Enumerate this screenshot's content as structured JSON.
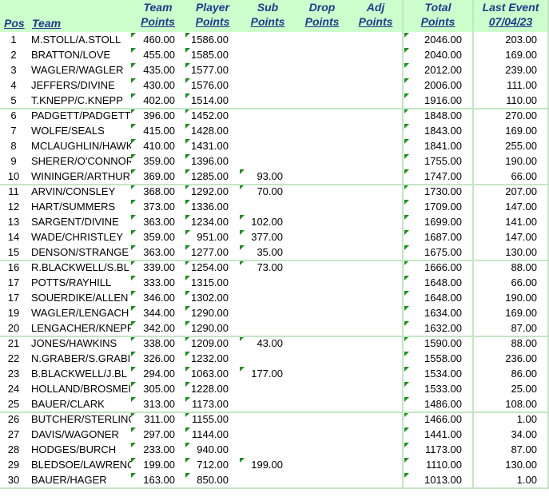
{
  "headers": {
    "pos": "Pos",
    "team": "Team",
    "team_points": [
      "Team",
      "Points"
    ],
    "player_points": [
      "Player",
      "Points"
    ],
    "sub_points": [
      "Sub",
      "Points"
    ],
    "drop_points": [
      "Drop",
      "Points"
    ],
    "adj_points": [
      "Adj",
      "Points"
    ],
    "total_points": [
      "Total",
      "Points"
    ],
    "last_event": [
      "Last Event",
      "07/04/23"
    ]
  },
  "rows": [
    {
      "pos": "1",
      "team": "M.STOLL/A.STOLL",
      "team_points": "460.00",
      "player_points": "1586.00",
      "sub_points": "",
      "total": "2046.00",
      "last_event": "203.00"
    },
    {
      "pos": "2",
      "team": "BRATTON/LOVE",
      "team_points": "455.00",
      "player_points": "1585.00",
      "sub_points": "",
      "total": "2040.00",
      "last_event": "169.00"
    },
    {
      "pos": "3",
      "team": "WAGLER/WAGLER",
      "team_points": "435.00",
      "player_points": "1577.00",
      "sub_points": "",
      "total": "2012.00",
      "last_event": "239.00"
    },
    {
      "pos": "4",
      "team": "JEFFERS/DIVINE",
      "team_points": "430.00",
      "player_points": "1576.00",
      "sub_points": "",
      "total": "2006.00",
      "last_event": "111.00"
    },
    {
      "pos": "5",
      "team": "T.KNEPP/C.KNEPP",
      "team_points": "402.00",
      "player_points": "1514.00",
      "sub_points": "",
      "total": "1916.00",
      "last_event": "110.00"
    },
    {
      "pos": "6",
      "team": "PADGETT/PADGETT",
      "team_points": "396.00",
      "player_points": "1452.00",
      "sub_points": "",
      "total": "1848.00",
      "last_event": "270.00"
    },
    {
      "pos": "7",
      "team": "WOLFE/SEALS",
      "team_points": "415.00",
      "player_points": "1428.00",
      "sub_points": "",
      "total": "1843.00",
      "last_event": "169.00"
    },
    {
      "pos": "8",
      "team": "MCLAUGHLIN/HAWK",
      "team_points": "410.00",
      "player_points": "1431.00",
      "sub_points": "",
      "total": "1841.00",
      "last_event": "255.00"
    },
    {
      "pos": "9",
      "team": "SHERER/O'CONNOR",
      "team_points": "359.00",
      "player_points": "1396.00",
      "sub_points": "",
      "total": "1755.00",
      "last_event": "190.00"
    },
    {
      "pos": "10",
      "team": "WININGER/ARTHUR",
      "team_points": "369.00",
      "player_points": "1285.00",
      "sub_points": "93.00",
      "total": "1747.00",
      "last_event": "66.00"
    },
    {
      "pos": "11",
      "team": "ARVIN/CONSLEY",
      "team_points": "368.00",
      "player_points": "1292.00",
      "sub_points": "70.00",
      "total": "1730.00",
      "last_event": "207.00"
    },
    {
      "pos": "12",
      "team": "HART/SUMMERS",
      "team_points": "373.00",
      "player_points": "1336.00",
      "sub_points": "",
      "total": "1709.00",
      "last_event": "147.00"
    },
    {
      "pos": "13",
      "team": "SARGENT/DIVINE",
      "team_points": "363.00",
      "player_points": "1234.00",
      "sub_points": "102.00",
      "total": "1699.00",
      "last_event": "141.00"
    },
    {
      "pos": "14",
      "team": "WADE/CHRISTLEY",
      "team_points": "359.00",
      "player_points": "951.00",
      "sub_points": "377.00",
      "total": "1687.00",
      "last_event": "147.00"
    },
    {
      "pos": "15",
      "team": "DENSON/STRANGE",
      "team_points": "363.00",
      "player_points": "1277.00",
      "sub_points": "35.00",
      "total": "1675.00",
      "last_event": "130.00"
    },
    {
      "pos": "16",
      "team": "R.BLACKWELL/S.BL",
      "team_points": "339.00",
      "player_points": "1254.00",
      "sub_points": "73.00",
      "total": "1666.00",
      "last_event": "88.00"
    },
    {
      "pos": "17",
      "team": "POTTS/RAYHILL",
      "team_points": "333.00",
      "player_points": "1315.00",
      "sub_points": "",
      "total": "1648.00",
      "last_event": "66.00"
    },
    {
      "pos": "17",
      "team": "SOUERDIKE/ALLEN",
      "team_points": "346.00",
      "player_points": "1302.00",
      "sub_points": "",
      "total": "1648.00",
      "last_event": "190.00"
    },
    {
      "pos": "19",
      "team": "WAGLER/LENGACH",
      "team_points": "344.00",
      "player_points": "1290.00",
      "sub_points": "",
      "total": "1634.00",
      "last_event": "169.00"
    },
    {
      "pos": "20",
      "team": "LENGACHER/KNEPP",
      "team_points": "342.00",
      "player_points": "1290.00",
      "sub_points": "",
      "total": "1632.00",
      "last_event": "87.00"
    },
    {
      "pos": "21",
      "team": "JONES/HAWKINS",
      "team_points": "338.00",
      "player_points": "1209.00",
      "sub_points": "43.00",
      "total": "1590.00",
      "last_event": "88.00"
    },
    {
      "pos": "22",
      "team": "N.GRABER/S.GRABI",
      "team_points": "326.00",
      "player_points": "1232.00",
      "sub_points": "",
      "total": "1558.00",
      "last_event": "236.00"
    },
    {
      "pos": "23",
      "team": "B.BLACKWELL/J.BL",
      "team_points": "294.00",
      "player_points": "1063.00",
      "sub_points": "177.00",
      "total": "1534.00",
      "last_event": "86.00"
    },
    {
      "pos": "24",
      "team": "HOLLAND/BROSMEI",
      "team_points": "305.00",
      "player_points": "1228.00",
      "sub_points": "",
      "total": "1533.00",
      "last_event": "25.00"
    },
    {
      "pos": "25",
      "team": "BAUER/CLARK",
      "team_points": "313.00",
      "player_points": "1173.00",
      "sub_points": "",
      "total": "1486.00",
      "last_event": "108.00"
    },
    {
      "pos": "26",
      "team": "BUTCHER/STERLING",
      "team_points": "311.00",
      "player_points": "1155.00",
      "sub_points": "",
      "total": "1466.00",
      "last_event": "1.00"
    },
    {
      "pos": "27",
      "team": "DAVIS/WAGONER",
      "team_points": "297.00",
      "player_points": "1144.00",
      "sub_points": "",
      "total": "1441.00",
      "last_event": "34.00"
    },
    {
      "pos": "28",
      "team": "HODGES/BURCH",
      "team_points": "233.00",
      "player_points": "940.00",
      "sub_points": "",
      "total": "1173.00",
      "last_event": "87.00"
    },
    {
      "pos": "29",
      "team": "BLEDSOE/LAWRENC",
      "team_points": "199.00",
      "player_points": "712.00",
      "sub_points": "199.00",
      "total": "1110.00",
      "last_event": "130.00"
    },
    {
      "pos": "30",
      "team": "BAUER/HAGER",
      "team_points": "163.00",
      "player_points": "850.00",
      "sub_points": "",
      "total": "1013.00",
      "last_event": "1.00"
    }
  ],
  "colors": {
    "header_bg": "#ccffcc",
    "header_text": "#1f3b8c",
    "grid_line": "#c3e6c3",
    "comment_marker": "#1a8f1a"
  }
}
